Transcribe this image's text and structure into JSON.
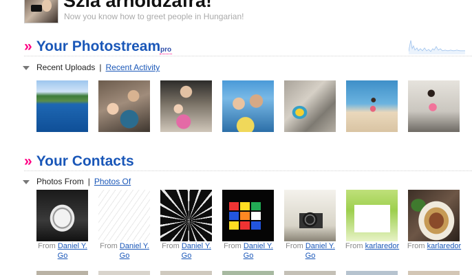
{
  "greeting": {
    "title": "Szia arnoldzafra!",
    "subtitle": "Now you know how to greet people in Hungarian!"
  },
  "photostream": {
    "raquo": "»",
    "title": "Your Photostream",
    "badge": "pro",
    "tabs": {
      "active_label": "Recent Uploads",
      "separator": "|",
      "other_label": "Recent Activity"
    },
    "photos": [
      {
        "icon": "infinity-pool-photo"
      },
      {
        "icon": "kids-in-car-photo"
      },
      {
        "icon": "family-selfie-photo"
      },
      {
        "icon": "kids-at-beach-photo"
      },
      {
        "icon": "beach-toy-shadow-photo"
      },
      {
        "icon": "child-on-shore-photo"
      },
      {
        "icon": "child-walking-sand-photo"
      }
    ]
  },
  "contacts": {
    "raquo": "»",
    "title": "Your Contacts",
    "tabs": {
      "active_label": "Photos From",
      "separator": "|",
      "other_label": "Photos Of"
    },
    "from_label": "From",
    "photos": [
      {
        "icon": "bike-helmet-photo",
        "author": "Daniel Y. Go"
      },
      {
        "icon": "sketch-drawing-photo",
        "author": "Daniel Y. Go"
      },
      {
        "icon": "spiral-staircase-photo",
        "author": "Daniel Y. Go"
      },
      {
        "icon": "rubiks-cube-photo",
        "author": "Daniel Y. Go"
      },
      {
        "icon": "vintage-camera-photo",
        "author": "Daniel Y. Go"
      },
      {
        "icon": "tgif-poster-photo",
        "author": "karlaredor"
      },
      {
        "icon": "food-plate-photo",
        "author": "karlaredor"
      }
    ]
  }
}
